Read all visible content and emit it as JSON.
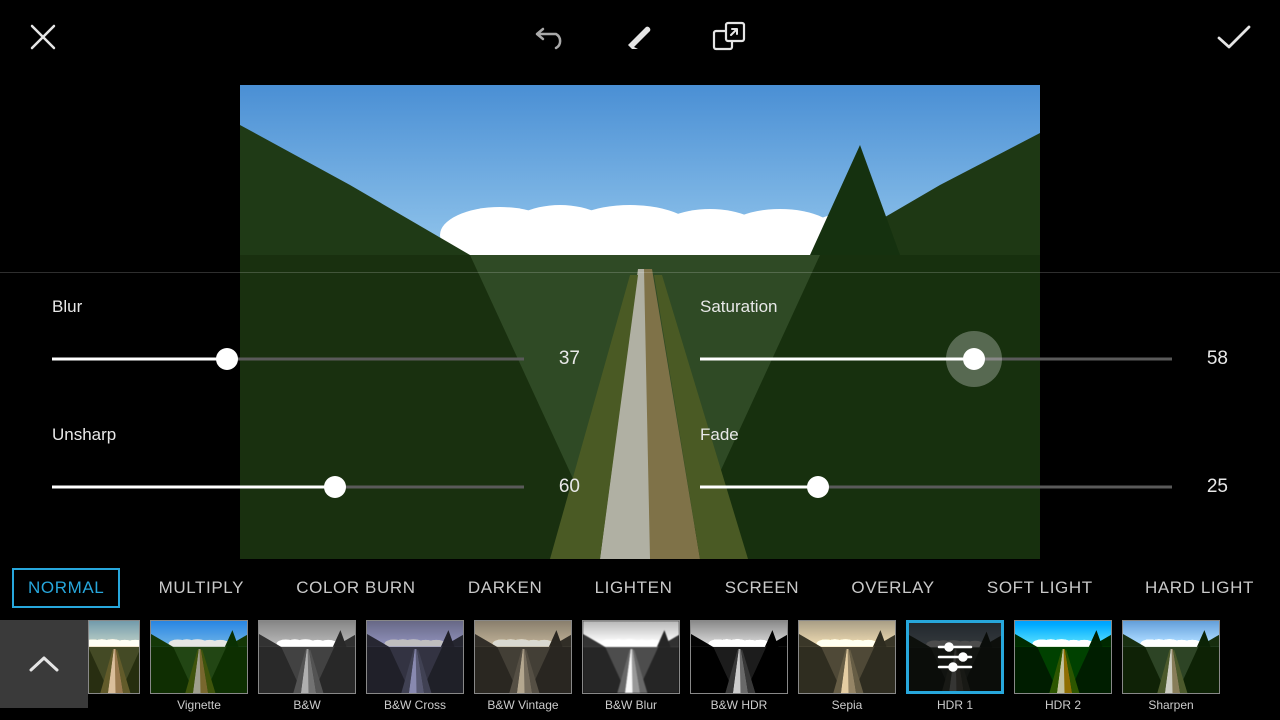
{
  "toolbar": {
    "close": "close-icon",
    "undo": "undo-icon",
    "eraser": "eraser-icon",
    "crop": "compare-icon",
    "apply": "check-icon"
  },
  "sliders": [
    {
      "label": "Blur",
      "value": 37,
      "active": false
    },
    {
      "label": "Saturation",
      "value": 58,
      "active": true
    },
    {
      "label": "Unsharp",
      "value": 60,
      "active": false
    },
    {
      "label": "Fade",
      "value": 25,
      "active": false
    }
  ],
  "blend_modes": {
    "selected": "NORMAL",
    "items": [
      "NORMAL",
      "MULTIPLY",
      "COLOR BURN",
      "DARKEN",
      "LIGHTEN",
      "SCREEN",
      "OVERLAY",
      "SOFT LIGHT",
      "HARD LIGHT"
    ]
  },
  "filters": {
    "selected": "HDR 1",
    "items": [
      {
        "label": "",
        "style": "sepia(0.5) saturate(1.4) hue-rotate(-10deg)"
      },
      {
        "label": "Vignette",
        "style": "saturate(1.5) brightness(0.9)"
      },
      {
        "label": "B&W",
        "style": "grayscale(1)"
      },
      {
        "label": "B&W Cross",
        "style": "grayscale(1) sepia(0.3) hue-rotate(200deg) saturate(3) brightness(0.75)"
      },
      {
        "label": "B&W Vintage",
        "style": "grayscale(1) sepia(0.6) brightness(0.85)"
      },
      {
        "label": "B&W Blur",
        "style": "grayscale(1) brightness(1.3) contrast(1.2) blur(0.6px)"
      },
      {
        "label": "B&W HDR",
        "style": "grayscale(1) contrast(1.6)"
      },
      {
        "label": "Sepia",
        "style": "sepia(0.9)"
      },
      {
        "label": "HDR 1",
        "style": "brightness(0.3) saturate(0.3)"
      },
      {
        "label": "HDR 2",
        "style": "saturate(1.9) contrast(1.35)"
      },
      {
        "label": "Sharpen",
        "style": "saturate(0.65) brightness(1.1) contrast(1.2)"
      }
    ]
  },
  "colors": {
    "accent": "#27a7dc"
  }
}
